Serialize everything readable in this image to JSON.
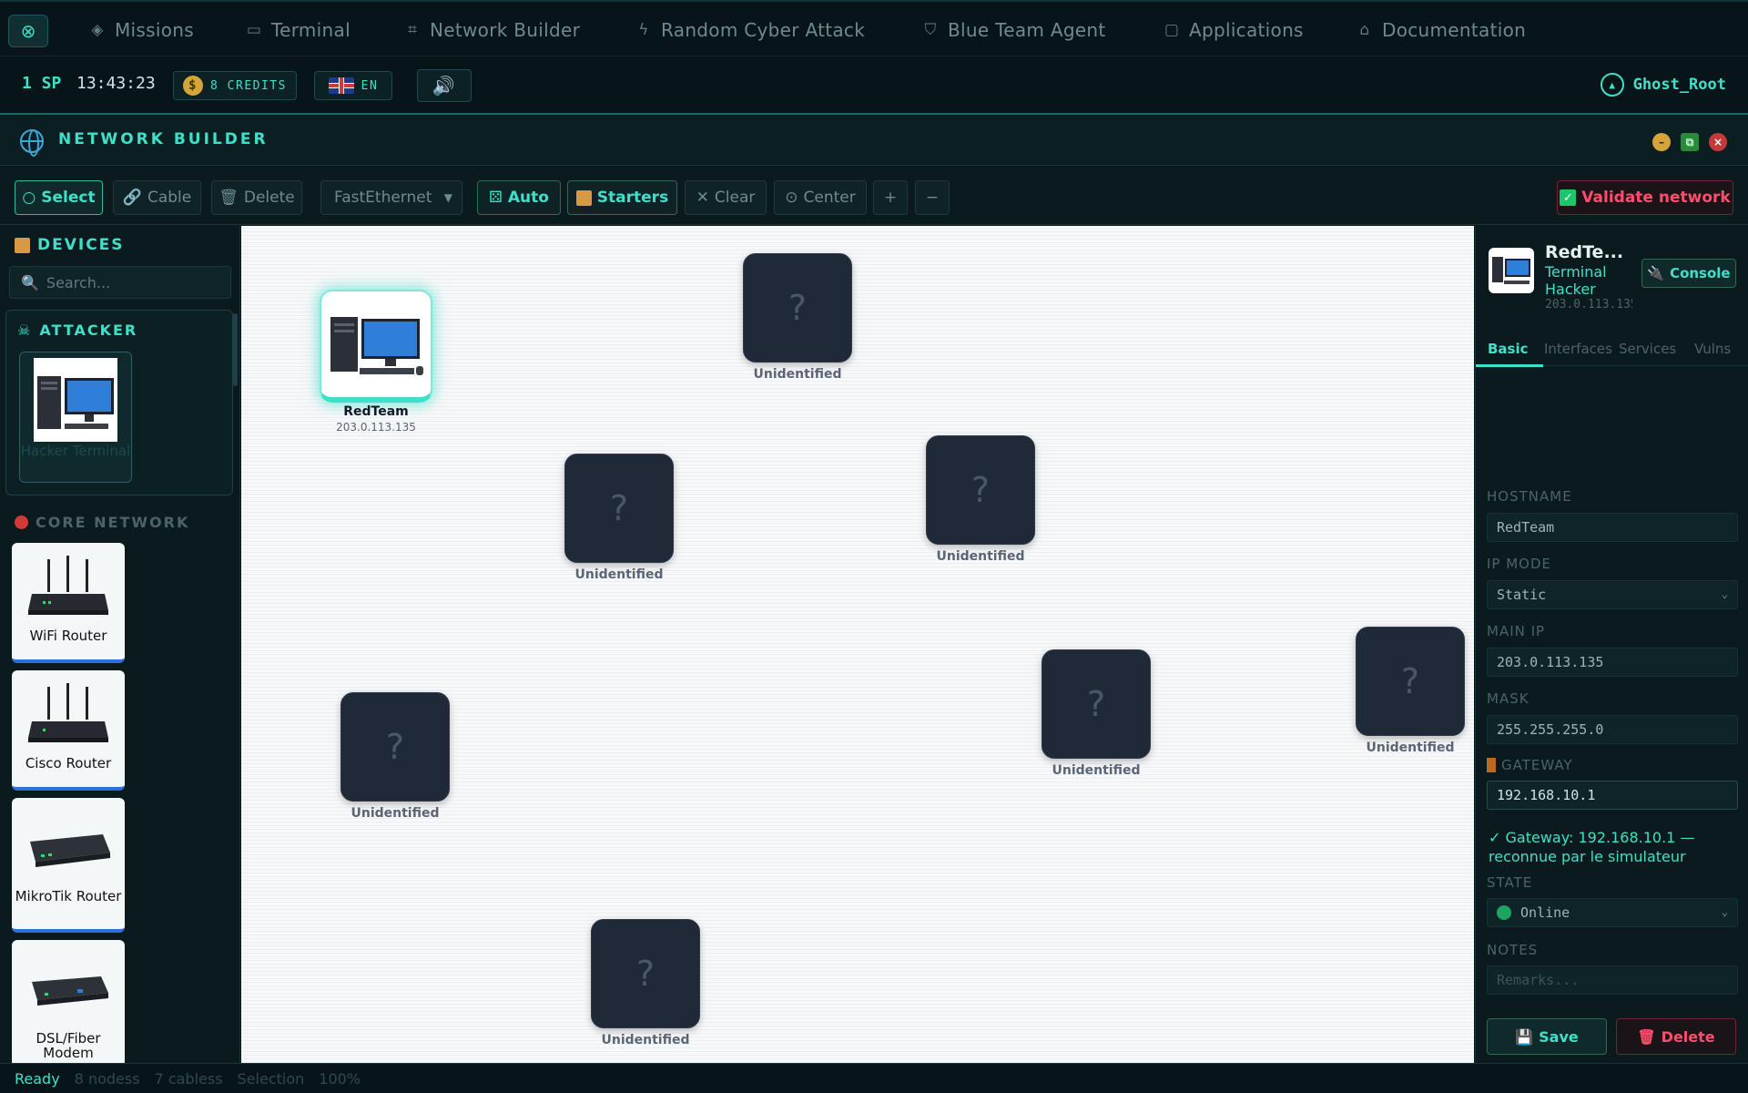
{
  "nav": {
    "items": [
      {
        "label": "Missions",
        "icon": "layers-icon"
      },
      {
        "label": "Terminal",
        "icon": "monitor-icon"
      },
      {
        "label": "Network Builder",
        "icon": "network-icon"
      },
      {
        "label": "Random Cyber Attack",
        "icon": "bolt-icon"
      },
      {
        "label": "Blue Team Agent",
        "icon": "shield-icon"
      },
      {
        "label": "Applications",
        "icon": "window-icon"
      },
      {
        "label": "Documentation",
        "icon": "graduation-cap-icon"
      }
    ]
  },
  "status": {
    "sp": "1 SP",
    "time": "13:43:23",
    "credits": "8 CREDITS",
    "lang": "EN",
    "user": "Ghost_Root"
  },
  "window": {
    "title": "NETWORK BUILDER"
  },
  "toolbar": {
    "select": "Select",
    "cable": "Cable",
    "delete": "Delete",
    "link_type": "FastEthernet",
    "auto": "Auto",
    "starters": "Starters",
    "clear": "Clear",
    "center": "Center",
    "zoom_in": "+",
    "zoom_out": "−",
    "validate": "Validate network"
  },
  "sidebar": {
    "title": "DEVICES",
    "search_placeholder": "Search...",
    "attacker_group": "ATTACKER",
    "attacker_device": "Hacker Terminal",
    "core_group": "CORE NETWORK",
    "devices": [
      {
        "label": "WiFi Router"
      },
      {
        "label": "Cisco Router"
      },
      {
        "label": "MikroTik Router"
      },
      {
        "label": "DSL/Fiber Modem"
      }
    ]
  },
  "canvas": {
    "redteam": {
      "name": "RedTeam",
      "ip": "203.0.113.135"
    },
    "unknown_label": "Unidentified",
    "unknown_glyph": "?"
  },
  "panel": {
    "name": "RedTe...",
    "subtitle": "Terminal Hacker",
    "ip": "203.0.113.135",
    "console": "Console",
    "tabs": [
      "Basic",
      "Interfaces",
      "Services",
      "Vulns"
    ],
    "hostname_label": "HOSTNAME",
    "hostname": "RedTeam",
    "ipmode_label": "IP MODE",
    "ipmode": "Static",
    "mainip_label": "MAIN IP",
    "mainip": "203.0.113.135",
    "mask_label": "MASK",
    "mask": "255.255.255.0",
    "gateway_label": "GATEWAY",
    "gateway": "192.168.10.1",
    "gateway_msg": "✓ Gateway: 192.168.10.1 — reconnue par le simulateur",
    "state_label": "STATE",
    "state": "Online",
    "notes_label": "NOTES",
    "notes_placeholder": "Remarks...",
    "save": "Save",
    "delete": "Delete"
  },
  "footer": {
    "ready": "Ready",
    "nodes": "8 nodess",
    "cables": "7 cabless",
    "selection": "Selection",
    "zoom": "100%"
  },
  "colors": {
    "accent": "#3fe0c9",
    "danger": "#ff4d6d",
    "background": "#071317"
  }
}
